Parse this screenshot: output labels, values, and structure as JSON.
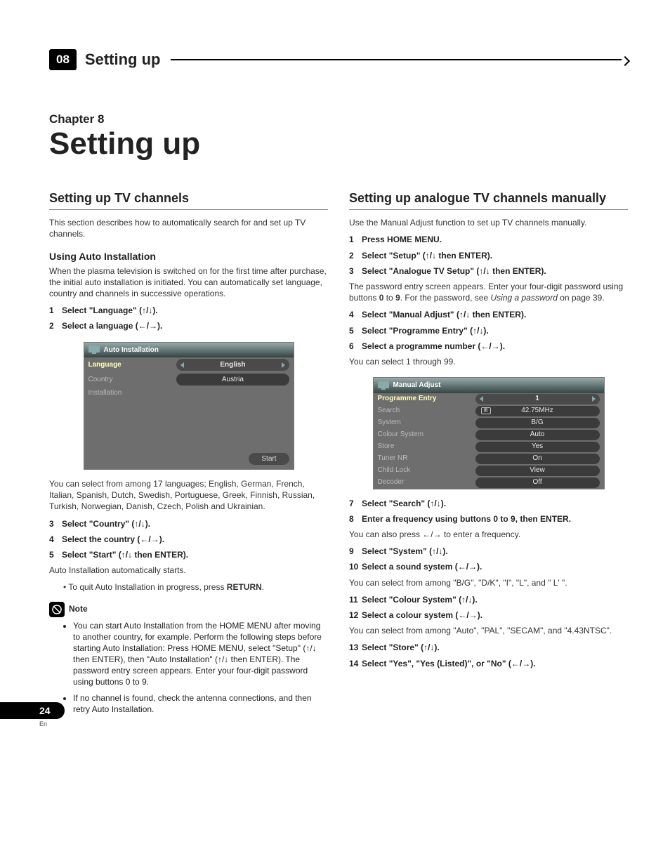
{
  "header": {
    "section_number": "08",
    "section_title": "Setting up"
  },
  "chapter": {
    "label": "Chapter 8",
    "title": "Setting up"
  },
  "left": {
    "h2": "Setting up TV channels",
    "intro": "This section describes how to automatically search for and set up TV channels.",
    "h3": "Using Auto Installation",
    "desc": "When the plasma television is switched on for the first time after purchase, the initial auto installation is initiated. You can automatically set language, country and channels in successive operations.",
    "steps1": [
      {
        "n": "1",
        "t": "Select \"Language\" (↑/↓)."
      },
      {
        "n": "2",
        "t": "Select a language (←/→)."
      }
    ],
    "after_osd": "You can select from among 17 languages; English, German, French, Italian, Spanish, Dutch, Swedish, Portuguese, Greek, Finnish, Russian, Turkish, Norwegian, Danish, Czech, Polish and Ukrainian.",
    "steps2": [
      {
        "n": "3",
        "t": "Select \"Country\" (↑/↓)."
      },
      {
        "n": "4",
        "t": "Select the country (←/→)."
      },
      {
        "n": "5",
        "t": "Select \"Start\" (↑/↓ then ENTER)."
      }
    ],
    "autostart": "Auto Installation automatically starts.",
    "bullet": "To quit Auto Installation in progress, press ",
    "bullet_b": "RETURN",
    "note_label": "Note",
    "notes": [
      "You can start Auto Installation from the HOME MENU after moving to another country, for example. Perform the following steps before starting Auto Installation: Press HOME MENU, select \"Setup\" (↑/↓ then ENTER), then \"Auto Installation\" (↑/↓ then ENTER). The password entry screen appears. Enter your four-digit password using buttons 0 to 9.",
      "If no channel is found, check the antenna connections, and then retry Auto Installation."
    ],
    "osd": {
      "title": "Auto Installation",
      "rows": [
        {
          "label": "Language",
          "value": "English",
          "sel": true,
          "arrows": true
        },
        {
          "label": "Country",
          "value": "Austria",
          "sel": false,
          "arrows": false
        },
        {
          "label": "Installation",
          "value": "",
          "sel": false,
          "arrows": false,
          "novalue": true
        }
      ],
      "button": "Start"
    }
  },
  "right": {
    "h2": "Setting up analogue TV channels manually",
    "intro": "Use the Manual Adjust function to set up TV channels manually.",
    "steps1": [
      {
        "n": "1",
        "t": "Press HOME MENU."
      },
      {
        "n": "2",
        "t": "Select \"Setup\" (↑/↓ then ENTER)."
      },
      {
        "n": "3",
        "t": "Select \"Analogue TV Setup\" (↑/↓ then ENTER)."
      }
    ],
    "pwd_a": "The password entry screen appears. Enter your four-digit password using buttons ",
    "pwd_b": "0",
    "pwd_c": " to ",
    "pwd_d": "9",
    "pwd_e": ". For the password, see ",
    "pwd_f": "Using a password",
    "pwd_g": " on page 39.",
    "steps2": [
      {
        "n": "4",
        "t": "Select \"Manual Adjust\" (↑/↓ then ENTER)."
      },
      {
        "n": "5",
        "t": "Select \"Programme Entry\" (↑/↓)."
      },
      {
        "n": "6",
        "t": "Select a programme number (←/→)."
      }
    ],
    "range": "You can select 1 through 99.",
    "osd": {
      "title": "Manual Adjust",
      "rows": [
        {
          "label": "Programme Entry",
          "value": "1",
          "sel": true,
          "arrows": true
        },
        {
          "label": "Search",
          "value": "42.75MHz",
          "icon": true
        },
        {
          "label": "System",
          "value": "B/G"
        },
        {
          "label": "Colour System",
          "value": "Auto"
        },
        {
          "label": "Store",
          "value": "Yes"
        },
        {
          "label": "Tuner NR",
          "value": "On"
        },
        {
          "label": "Child Lock",
          "value": "View"
        },
        {
          "label": "Decoder",
          "value": "Off"
        }
      ]
    },
    "steps3": [
      {
        "n": "7",
        "t": "Select \"Search\" (↑/↓)."
      },
      {
        "n": "8",
        "t": "Enter a frequency using buttons 0 to 9, then ENTER."
      }
    ],
    "freq_note": "You can also press ←/→ to enter a frequency.",
    "steps4": [
      {
        "n": "9",
        "t": "Select \"System\" (↑/↓)."
      },
      {
        "n": "10",
        "t": "Select a sound system (←/→)."
      }
    ],
    "sound_note": "You can select from among \"B/G\", \"D/K\", \"I\", \"L\", and \" L' \".",
    "steps5": [
      {
        "n": "11",
        "t": "Select \"Colour System\" (↑/↓)."
      },
      {
        "n": "12",
        "t": "Select a colour system (←/→)."
      }
    ],
    "colour_note": "You can select from among \"Auto\", \"PAL\", \"SECAM\", and \"4.43NTSC\".",
    "steps6": [
      {
        "n": "13",
        "t": "Select \"Store\" (↑/↓)."
      },
      {
        "n": "14",
        "t": "Select \"Yes\", \"Yes (Listed)\", or \"No\" (←/→)."
      }
    ]
  },
  "page": {
    "number": "24",
    "lang": "En"
  }
}
